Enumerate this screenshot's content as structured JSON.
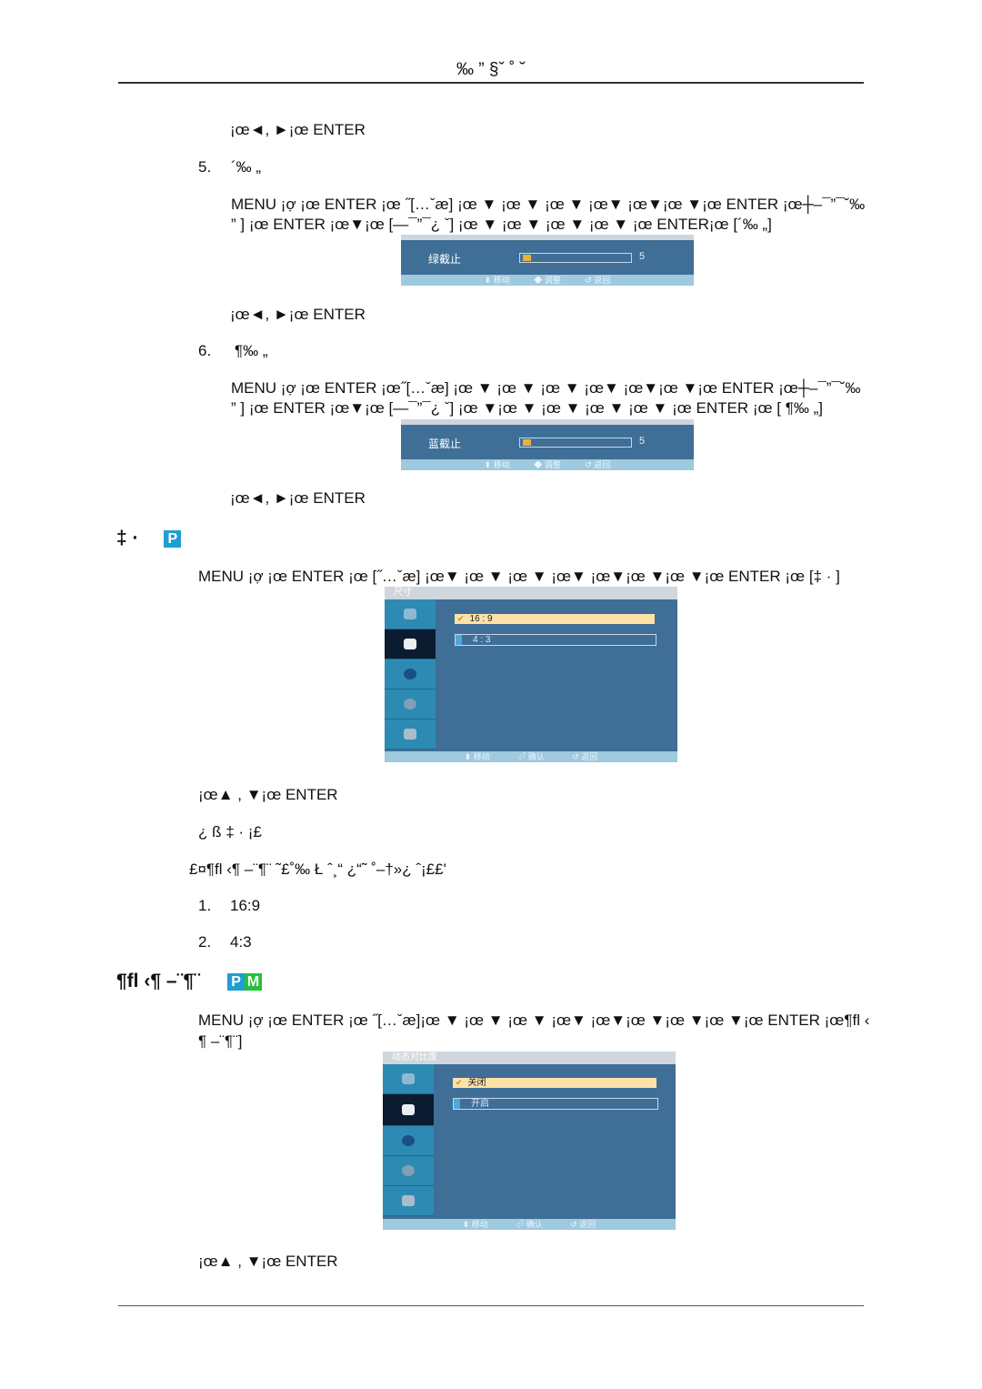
{
  "header": {
    "title": "‰ ” §ˇ ˚ ˘"
  },
  "sections": {
    "step_hint_1": "¡œ◄,  ►¡œ ENTER",
    "item5": {
      "number": "5.",
      "title": "´‰ „",
      "instr_line1": "MENU ¡ợ ¡œ ENTER ¡œ ˝[…ˇæ]  ¡œ ▼ ¡œ  ▼ ¡œ  ▼ ¡œ▼ ¡œ▼¡œ ▼¡œ ENTER ¡œ┼–¯”¯˘‰",
      "instr_line2": "”  ] ¡œ ENTER ¡œ▼¡œ [—¯”¯¿  ˇ] ¡œ     ▼ ¡œ ▼ ¡œ ▼ ¡œ ▼ ¡œ ENTER¡œ [´‰ „]",
      "osd": {
        "label": "绿截止",
        "value": "5",
        "level_fraction": 0.05,
        "footer": [
          "⬍ 移动",
          "◆ 调整",
          "↺ 返回"
        ]
      },
      "hint": "¡œ◄,  ►¡œ ENTER"
    },
    "item6": {
      "number": "6.",
      "title": "¶‰ „",
      "instr_line1": "MENU ¡ợ ¡œ  ENTER ¡œ˝[…ˇæ]  ¡œ ▼ ¡œ  ▼ ¡œ  ▼ ¡œ▼ ¡œ▼¡œ ▼¡œ ENTER ¡œ┼–¯”¯˘‰",
      "instr_line2": "”  ] ¡œ ENTER ¡œ▼¡œ [—¯”¯¿  ˇ] ¡œ     ▼¡œ ▼ ¡œ ▼ ¡œ ▼ ¡œ ▼ ¡œ ENTER ¡œ [ ¶‰ „]",
      "osd": {
        "label": "蓝截止",
        "value": "5",
        "level_fraction": 0.05,
        "footer": [
          "⬍ 移动",
          "◆ 调整",
          "↺ 返回"
        ]
      },
      "hint": "¡œ◄,  ►¡œ ENTER"
    },
    "size": {
      "heading": "‡ ·",
      "badges": [
        "P"
      ],
      "instr": "MENU ¡ợ ¡œ ENTER ¡œ [˝…ˇæ] ¡œ▼ ¡œ  ▼ ¡œ  ▼ ¡œ▼ ¡œ▼¡œ ▼¡œ ▼¡œ ENTER ¡œ [‡ · ]",
      "osd": {
        "title": "尺寸",
        "options": [
          {
            "label": "16 : 9",
            "selected": true
          },
          {
            "label": "4 : 3",
            "selected": false
          }
        ],
        "footer": [
          "⬍ 移动",
          "⏎ 确认",
          "↺ 返回"
        ]
      },
      "hint": "¡œ▲ ,   ▼¡œ ENTER",
      "note1": "¿    ß ‡ · ¡£",
      "note2": "£¤¶ﬂ ‹¶ –¨¶¨ ˜£˚‰ Ł ˆ¸“ ¿“˜  ˚–†»¿  ˆ¡££'",
      "list": [
        {
          "num": "1.",
          "text": "16:9"
        },
        {
          "num": "2.",
          "text": "4:3"
        }
      ]
    },
    "dynamic_contrast": {
      "heading": "¶ﬂ ‹¶ –¨¶¨",
      "badges": [
        "P",
        "M"
      ],
      "instr_line1": "MENU ¡ợ ¡œ ENTER ¡œ ˝[…ˇæ]¡œ  ▼ ¡œ ▼ ¡œ  ▼ ¡œ▼ ¡œ▼¡œ ▼¡œ ▼¡œ ▼¡œ ENTER ¡œ¶ﬂ ‹",
      "instr_line2": "¶ –¨¶¨]",
      "osd": {
        "title": "动态对比度",
        "options": [
          {
            "label": "关闭",
            "selected": true
          },
          {
            "label": "开启",
            "selected": false
          }
        ],
        "footer": [
          "⬍ 移动",
          "⏎ 确认",
          "↺ 返回"
        ]
      },
      "hint": "¡œ▲ ,   ▼¡œ ENTER"
    }
  },
  "osd_sidebar_icons": [
    "satellite-dish-icon",
    "picture-icon",
    "sound-icon",
    "setup-gear-icon",
    "multi-screen-icon"
  ],
  "colors": {
    "osd_blue": "#3f6f97",
    "osd_sidebar": "#2d8bb3",
    "osd_selected": "#fde2a8",
    "badge_p": "#1e9fd0",
    "badge_m": "#23c23a"
  }
}
